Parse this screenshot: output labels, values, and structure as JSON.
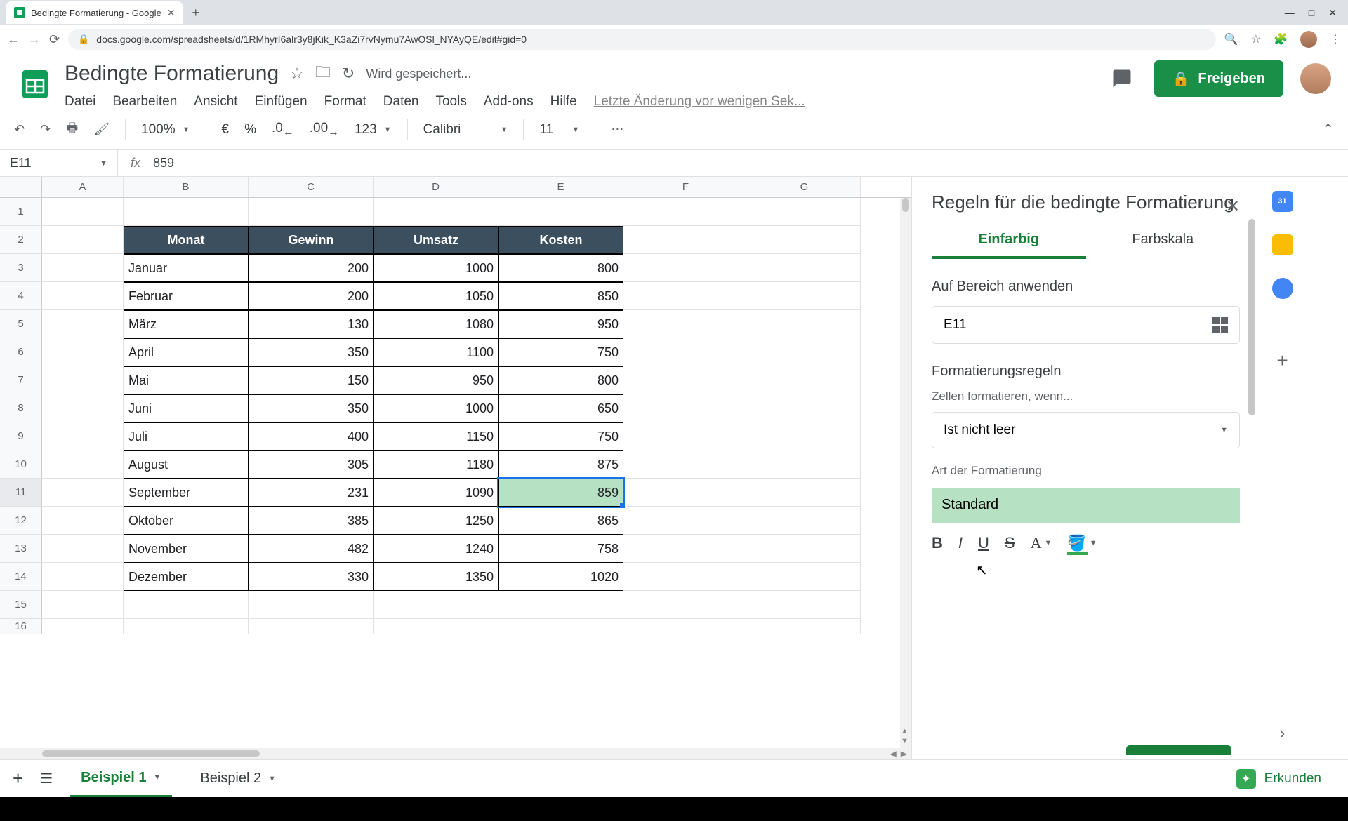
{
  "browser": {
    "tab_title": "Bedingte Formatierung - Google",
    "url": "docs.google.com/spreadsheets/d/1RMhyrI6alr3y8jKik_K3aZi7rvNymu7AwOSl_NYAyQE/edit#gid=0"
  },
  "doc": {
    "logo_color": "#0f9d58",
    "title": "Bedingte Formatierung",
    "saving": "Wird gespeichert...",
    "menu": [
      "Datei",
      "Bearbeiten",
      "Ansicht",
      "Einfügen",
      "Format",
      "Daten",
      "Tools",
      "Add-ons",
      "Hilfe"
    ],
    "last_edit": "Letzte Änderung vor wenigen Sek...",
    "share": "Freigeben"
  },
  "toolbar": {
    "zoom": "100%",
    "currency": "€",
    "percent": "%",
    "dec_dec": ".0",
    "dec_inc": ".00",
    "num_fmt": "123",
    "font": "Calibri",
    "size": "11"
  },
  "fx": {
    "name": "E11",
    "value": "859"
  },
  "cols": [
    "A",
    "B",
    "C",
    "D",
    "E",
    "F",
    "G"
  ],
  "rows_blank_before": 1,
  "table": {
    "headers": [
      "Monat",
      "Gewinn",
      "Umsatz",
      "Kosten"
    ],
    "rows": [
      [
        "Januar",
        "200",
        "1000",
        "800"
      ],
      [
        "Februar",
        "200",
        "1050",
        "850"
      ],
      [
        "März",
        "130",
        "1080",
        "950"
      ],
      [
        "April",
        "350",
        "1100",
        "750"
      ],
      [
        "Mai",
        "150",
        "950",
        "800"
      ],
      [
        "Juni",
        "350",
        "1000",
        "650"
      ],
      [
        "Juli",
        "400",
        "1150",
        "750"
      ],
      [
        "August",
        "305",
        "1180",
        "875"
      ],
      [
        "September",
        "231",
        "1090",
        "859"
      ],
      [
        "Oktober",
        "385",
        "1250",
        "865"
      ],
      [
        "November",
        "482",
        "1240",
        "758"
      ],
      [
        "Dezember",
        "330",
        "1350",
        "1020"
      ]
    ],
    "highlight_row_index": 8,
    "highlight_col_index": 3
  },
  "sidebar": {
    "title": "Regeln für die bedingte Formatierung",
    "tabs": [
      "Einfarbig",
      "Farbskala"
    ],
    "active_tab": 0,
    "apply_label": "Auf Bereich anwenden",
    "range": "E11",
    "rules_label": "Formatierungsregeln",
    "cond_label": "Zellen formatieren, wenn...",
    "cond_value": "Ist nicht leer",
    "style_label": "Art der Formatierung",
    "style_value": "Standard"
  },
  "sheets": {
    "add": "+",
    "tabs": [
      {
        "name": "Beispiel 1",
        "active": true
      },
      {
        "name": "Beispiel 2",
        "active": false
      }
    ],
    "explore": "Erkunden"
  }
}
